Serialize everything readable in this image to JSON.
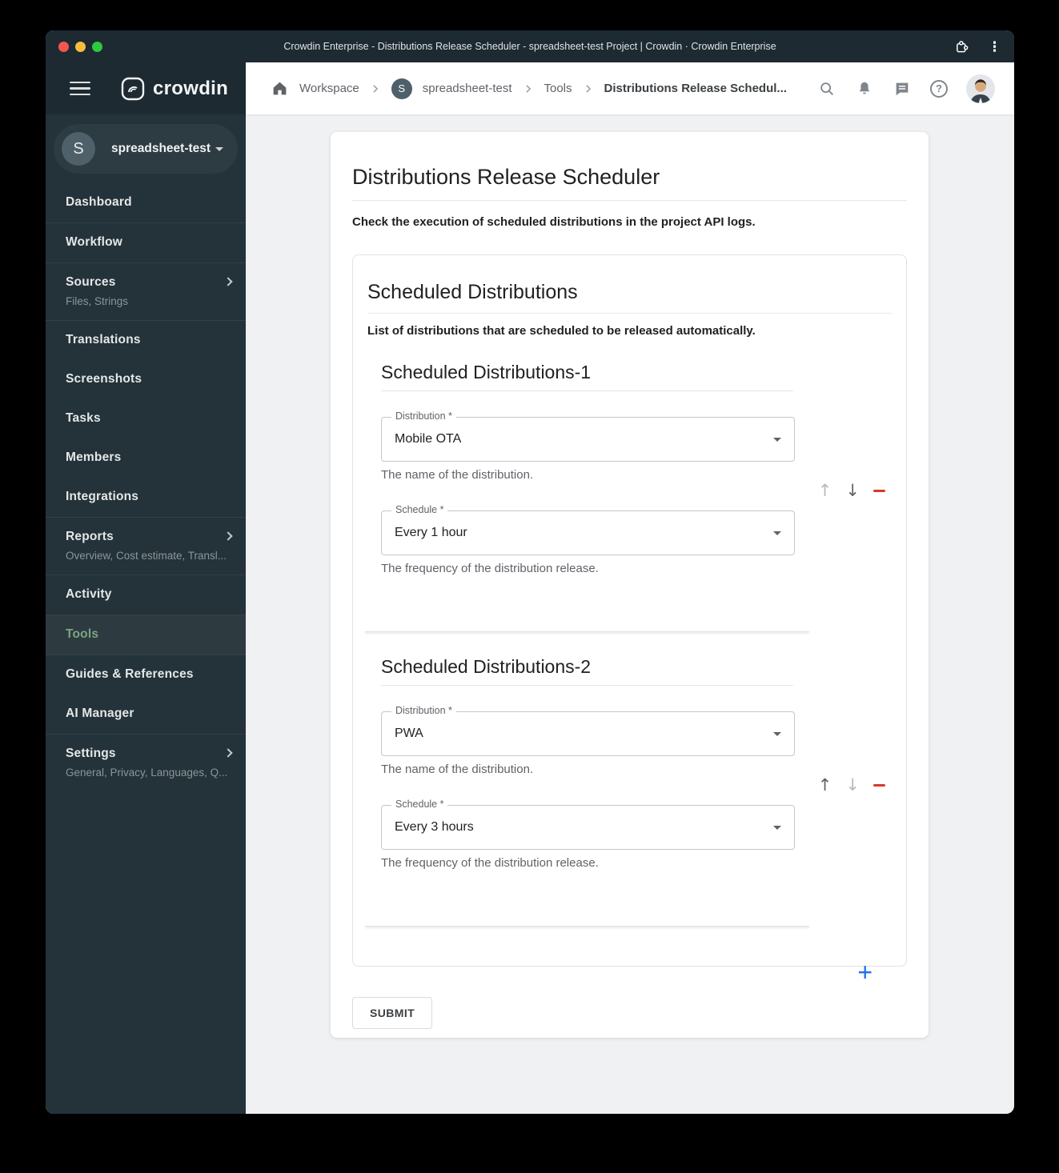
{
  "colors": {
    "titlebar-bg": "#1d2a32",
    "sidebar-bg": "#243239",
    "sidebar-header-bg": "#1d2a32",
    "sidebar-active-bg": "#2d3b41",
    "accent-green": "#79a57f",
    "accent-blue": "#1a73e8",
    "accent-red": "#d33a2c",
    "traffic-red": "#f4574e",
    "traffic-yellow": "#f6bd3e",
    "traffic-green": "#2fc840",
    "main-bg": "#eff1f2"
  },
  "icons": {
    "kebab_menu": "⋮",
    "question_mark": "?",
    "up_arrow": "↑",
    "down_arrow": "↓",
    "plus": "+"
  },
  "window": {
    "title": "Crowdin Enterprise - Distributions Release Scheduler - spreadsheet-test Project | Crowdin · Crowdin Enterprise"
  },
  "sidebar": {
    "logo_text": "crowdin",
    "project": {
      "initial": "S",
      "name": "spreadsheet-test"
    },
    "items": [
      {
        "label": "Dashboard"
      },
      {
        "label": "Workflow"
      },
      {
        "label": "Sources",
        "subtitle": "Files, Strings"
      },
      {
        "label": "Translations"
      },
      {
        "label": "Screenshots"
      },
      {
        "label": "Tasks"
      },
      {
        "label": "Members"
      },
      {
        "label": "Integrations"
      },
      {
        "label": "Reports",
        "subtitle": "Overview, Cost estimate, Transl..."
      },
      {
        "label": "Activity"
      },
      {
        "label": "Tools",
        "active": true
      },
      {
        "label": "Guides & References"
      },
      {
        "label": "AI Manager"
      },
      {
        "label": "Settings",
        "subtitle": "General, Privacy, Languages, Q..."
      }
    ]
  },
  "breadcrumb": {
    "project_initial": "S",
    "items": [
      "Workspace",
      "spreadsheet-test",
      "Tools",
      "Distributions Release Schedul..."
    ]
  },
  "page": {
    "title": "Distributions Release Scheduler",
    "description": "Check the execution of scheduled distributions in the project API logs.",
    "panel": {
      "title": "Scheduled Distributions",
      "description": "List of distributions that are scheduled to be released automatically.",
      "sections": [
        {
          "title": "Scheduled Distributions-1",
          "move_up_enabled": false,
          "move_down_enabled": true,
          "fields": [
            {
              "label": "Distribution *",
              "value": "Mobile OTA",
              "helper": "The name of the distribution."
            },
            {
              "label": "Schedule *",
              "value": "Every 1 hour",
              "helper": "The frequency of the distribution release."
            }
          ]
        },
        {
          "title": "Scheduled Distributions-2",
          "move_up_enabled": true,
          "move_down_enabled": false,
          "fields": [
            {
              "label": "Distribution *",
              "value": "PWA",
              "helper": "The name of the distribution."
            },
            {
              "label": "Schedule *",
              "value": "Every 3 hours",
              "helper": "The frequency of the distribution release."
            }
          ]
        }
      ]
    },
    "submit_label": "SUBMIT"
  }
}
